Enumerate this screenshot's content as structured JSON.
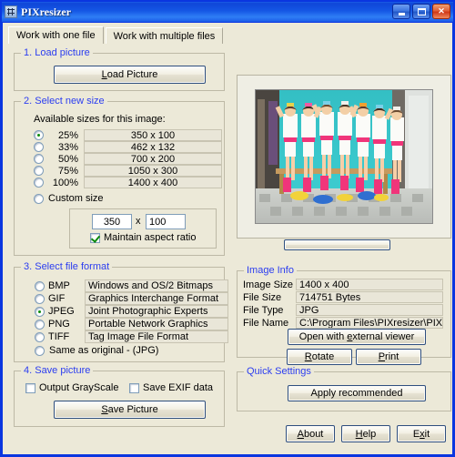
{
  "window": {
    "title": "PIXresizer",
    "icon": "app-grid-icon",
    "buttons": {
      "minimize": "_",
      "maximize": "□",
      "close": "✕"
    }
  },
  "tabs": [
    {
      "label": "Work with one file",
      "active": true
    },
    {
      "label": "Work with multiple files",
      "active": false
    }
  ],
  "sections": {
    "load_picture": {
      "title": "1. Load picture",
      "button": "Load Picture"
    },
    "select_new_size": {
      "title": "2. Select new size",
      "available_label": "Available sizes for this image:",
      "sizes": [
        {
          "percent": "25%",
          "dimensions": "350 x 100",
          "selected": true
        },
        {
          "percent": "33%",
          "dimensions": "462 x 132",
          "selected": false
        },
        {
          "percent": "50%",
          "dimensions": "700 x 200",
          "selected": false
        },
        {
          "percent": "75%",
          "dimensions": "1050 x 300",
          "selected": false
        },
        {
          "percent": "100%",
          "dimensions": "1400 x 400",
          "selected": false
        }
      ],
      "custom_size_label": "Custom size",
      "custom_selected": false,
      "width_value": "350",
      "height_value": "100",
      "times_symbol": "x",
      "maintain_aspect_label": "Maintain aspect ratio",
      "maintain_aspect_checked": true
    },
    "select_file_format": {
      "title": "3. Select file format",
      "formats": [
        {
          "name": "BMP",
          "description": "Windows and OS/2 Bitmaps",
          "selected": false
        },
        {
          "name": "GIF",
          "description": "Graphics Interchange Format",
          "selected": false
        },
        {
          "name": "JPEG",
          "description": "Joint Photographic Experts Group",
          "selected": true
        },
        {
          "name": "PNG",
          "description": "Portable Network Graphics",
          "selected": false
        },
        {
          "name": "TIFF",
          "description": "Tag Image File Format",
          "selected": false
        }
      ],
      "same_as_original_label": "Same as original  - (JPG)",
      "same_as_original_selected": false
    },
    "save_picture": {
      "title": "4. Save picture",
      "grayscale_label": "Output GrayScale",
      "grayscale_checked": false,
      "exif_label": "Save EXIF data",
      "exif_checked": false,
      "button": "Save Picture"
    },
    "image_info": {
      "title": "Image Info",
      "rows": [
        {
          "label": "Image Size",
          "value": "1400 x 400"
        },
        {
          "label": "File Size",
          "value": "714751 Bytes"
        },
        {
          "label": "File Type",
          "value": "JPG"
        },
        {
          "label": "File Name",
          "value": "C:\\Program Files\\PIXresizer\\PIXresiz"
        }
      ],
      "open_external_button": "Open with external viewer",
      "rotate_button": "Rotate",
      "print_button": "Print"
    },
    "quick_settings": {
      "title": "Quick Settings",
      "apply_button": "Apply recommended"
    }
  },
  "footer": {
    "about_button": "About",
    "help_button": "Help",
    "exit_button": "Exit"
  },
  "preview": {
    "alt": "photo-preview"
  },
  "colors": {
    "titlebar_blue": "#1557e5",
    "client_bg": "#ece9d8",
    "group_title_blue": "#2b3df0",
    "radio_selected_green": "#0a8a0a"
  }
}
